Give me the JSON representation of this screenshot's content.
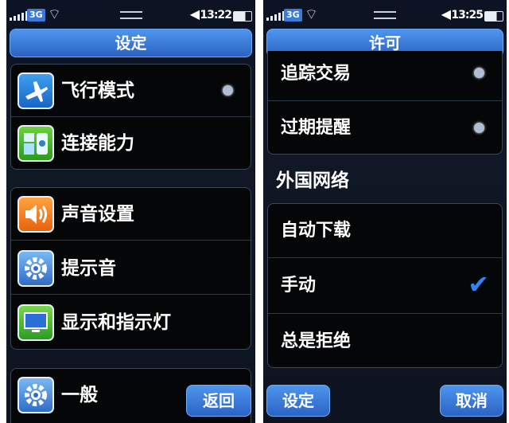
{
  "left": {
    "status": {
      "network": "3G",
      "time": "13:22"
    },
    "title": "设定",
    "group1": [
      {
        "label": "飞行模式",
        "icon": "airplane-icon",
        "toggle": "off"
      },
      {
        "label": "连接能力",
        "icon": "connectivity-icon"
      }
    ],
    "group2": [
      {
        "label": "声音设置",
        "icon": "speaker-icon"
      },
      {
        "label": "提示音",
        "icon": "gear-icon"
      },
      {
        "label": "显示和指示灯",
        "icon": "monitor-icon"
      }
    ],
    "group3": [
      {
        "label": "一般",
        "icon": "gear-icon"
      }
    ],
    "back_label": "返回"
  },
  "right": {
    "status": {
      "network": "3G",
      "time": "13:25"
    },
    "title": "许可",
    "group1": [
      {
        "label": "追踪交易",
        "toggle": "off"
      },
      {
        "label": "过期提醒",
        "toggle": "off"
      }
    ],
    "section_label": "外国网络",
    "options": [
      {
        "label": "自动下载",
        "selected": false
      },
      {
        "label": "手动",
        "selected": true
      },
      {
        "label": "总是拒绝",
        "selected": false
      }
    ],
    "settings_label": "设定",
    "cancel_label": "取消"
  },
  "colors": {
    "accent": "#2f86f2",
    "titlebar": "#3a7ad8"
  }
}
